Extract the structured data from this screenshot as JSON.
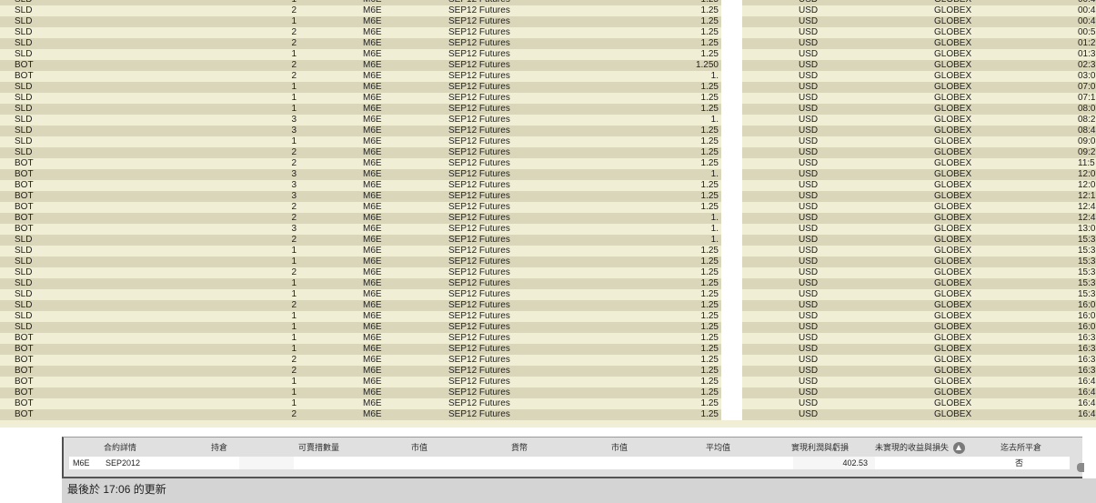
{
  "trades": {
    "rows": [
      {
        "action": "SLD",
        "qty": "1",
        "symbol": "M6E",
        "description": "SEP12 Futures",
        "price": "1.25",
        "currency": "USD",
        "exchange": "GLOBEX",
        "time": "00:4"
      },
      {
        "action": "SLD",
        "qty": "2",
        "symbol": "M6E",
        "description": "SEP12 Futures",
        "price": "1.25",
        "currency": "USD",
        "exchange": "GLOBEX",
        "time": "00:4"
      },
      {
        "action": "SLD",
        "qty": "1",
        "symbol": "M6E",
        "description": "SEP12 Futures",
        "price": "1.25",
        "currency": "USD",
        "exchange": "GLOBEX",
        "time": "00:4"
      },
      {
        "action": "SLD",
        "qty": "2",
        "symbol": "M6E",
        "description": "SEP12 Futures",
        "price": "1.25",
        "currency": "USD",
        "exchange": "GLOBEX",
        "time": "00:5"
      },
      {
        "action": "SLD",
        "qty": "2",
        "symbol": "M6E",
        "description": "SEP12 Futures",
        "price": "1.25",
        "currency": "USD",
        "exchange": "GLOBEX",
        "time": "01:2"
      },
      {
        "action": "SLD",
        "qty": "1",
        "symbol": "M6E",
        "description": "SEP12 Futures",
        "price": "1.25",
        "currency": "USD",
        "exchange": "GLOBEX",
        "time": "01:3"
      },
      {
        "action": "BOT",
        "qty": "2",
        "symbol": "M6E",
        "description": "SEP12 Futures",
        "price": "1.250",
        "currency": "USD",
        "exchange": "GLOBEX",
        "time": "02:3"
      },
      {
        "action": "BOT",
        "qty": "2",
        "symbol": "M6E",
        "description": "SEP12 Futures",
        "price": "1.",
        "currency": "USD",
        "exchange": "GLOBEX",
        "time": "03:0"
      },
      {
        "action": "SLD",
        "qty": "1",
        "symbol": "M6E",
        "description": "SEP12 Futures",
        "price": "1.25",
        "currency": "USD",
        "exchange": "GLOBEX",
        "time": "07:0"
      },
      {
        "action": "SLD",
        "qty": "1",
        "symbol": "M6E",
        "description": "SEP12 Futures",
        "price": "1.25",
        "currency": "USD",
        "exchange": "GLOBEX",
        "time": "07:1"
      },
      {
        "action": "SLD",
        "qty": "1",
        "symbol": "M6E",
        "description": "SEP12 Futures",
        "price": "1.25",
        "currency": "USD",
        "exchange": "GLOBEX",
        "time": "08:0"
      },
      {
        "action": "SLD",
        "qty": "3",
        "symbol": "M6E",
        "description": "SEP12 Futures",
        "price": "1.",
        "currency": "USD",
        "exchange": "GLOBEX",
        "time": "08:2"
      },
      {
        "action": "SLD",
        "qty": "3",
        "symbol": "M6E",
        "description": "SEP12 Futures",
        "price": "1.25",
        "currency": "USD",
        "exchange": "GLOBEX",
        "time": "08:4"
      },
      {
        "action": "SLD",
        "qty": "1",
        "symbol": "M6E",
        "description": "SEP12 Futures",
        "price": "1.25",
        "currency": "USD",
        "exchange": "GLOBEX",
        "time": "09:0"
      },
      {
        "action": "SLD",
        "qty": "2",
        "symbol": "M6E",
        "description": "SEP12 Futures",
        "price": "1.25",
        "currency": "USD",
        "exchange": "GLOBEX",
        "time": "09:2"
      },
      {
        "action": "BOT",
        "qty": "2",
        "symbol": "M6E",
        "description": "SEP12 Futures",
        "price": "1.25",
        "currency": "USD",
        "exchange": "GLOBEX",
        "time": "11:5"
      },
      {
        "action": "BOT",
        "qty": "3",
        "symbol": "M6E",
        "description": "SEP12 Futures",
        "price": "1.",
        "currency": "USD",
        "exchange": "GLOBEX",
        "time": "12:0"
      },
      {
        "action": "BOT",
        "qty": "3",
        "symbol": "M6E",
        "description": "SEP12 Futures",
        "price": "1.25",
        "currency": "USD",
        "exchange": "GLOBEX",
        "time": "12:0"
      },
      {
        "action": "BOT",
        "qty": "3",
        "symbol": "M6E",
        "description": "SEP12 Futures",
        "price": "1.25",
        "currency": "USD",
        "exchange": "GLOBEX",
        "time": "12:1"
      },
      {
        "action": "BOT",
        "qty": "2",
        "symbol": "M6E",
        "description": "SEP12 Futures",
        "price": "1.25",
        "currency": "USD",
        "exchange": "GLOBEX",
        "time": "12:4"
      },
      {
        "action": "BOT",
        "qty": "2",
        "symbol": "M6E",
        "description": "SEP12 Futures",
        "price": "1.",
        "currency": "USD",
        "exchange": "GLOBEX",
        "time": "12:4"
      },
      {
        "action": "BOT",
        "qty": "3",
        "symbol": "M6E",
        "description": "SEP12 Futures",
        "price": "1.",
        "currency": "USD",
        "exchange": "GLOBEX",
        "time": "13:0"
      },
      {
        "action": "SLD",
        "qty": "2",
        "symbol": "M6E",
        "description": "SEP12 Futures",
        "price": "1.",
        "currency": "USD",
        "exchange": "GLOBEX",
        "time": "15:3"
      },
      {
        "action": "SLD",
        "qty": "1",
        "symbol": "M6E",
        "description": "SEP12 Futures",
        "price": "1.25",
        "currency": "USD",
        "exchange": "GLOBEX",
        "time": "15:3"
      },
      {
        "action": "SLD",
        "qty": "1",
        "symbol": "M6E",
        "description": "SEP12 Futures",
        "price": "1.25",
        "currency": "USD",
        "exchange": "GLOBEX",
        "time": "15:3"
      },
      {
        "action": "SLD",
        "qty": "2",
        "symbol": "M6E",
        "description": "SEP12 Futures",
        "price": "1.25",
        "currency": "USD",
        "exchange": "GLOBEX",
        "time": "15:3"
      },
      {
        "action": "SLD",
        "qty": "1",
        "symbol": "M6E",
        "description": "SEP12 Futures",
        "price": "1.25",
        "currency": "USD",
        "exchange": "GLOBEX",
        "time": "15:3"
      },
      {
        "action": "SLD",
        "qty": "1",
        "symbol": "M6E",
        "description": "SEP12 Futures",
        "price": "1.25",
        "currency": "USD",
        "exchange": "GLOBEX",
        "time": "15:3"
      },
      {
        "action": "SLD",
        "qty": "2",
        "symbol": "M6E",
        "description": "SEP12 Futures",
        "price": "1.25",
        "currency": "USD",
        "exchange": "GLOBEX",
        "time": "16:0"
      },
      {
        "action": "SLD",
        "qty": "1",
        "symbol": "M6E",
        "description": "SEP12 Futures",
        "price": "1.25",
        "currency": "USD",
        "exchange": "GLOBEX",
        "time": "16:0"
      },
      {
        "action": "SLD",
        "qty": "1",
        "symbol": "M6E",
        "description": "SEP12 Futures",
        "price": "1.25",
        "currency": "USD",
        "exchange": "GLOBEX",
        "time": "16:0"
      },
      {
        "action": "BOT",
        "qty": "1",
        "symbol": "M6E",
        "description": "SEP12 Futures",
        "price": "1.25",
        "currency": "USD",
        "exchange": "GLOBEX",
        "time": "16:3"
      },
      {
        "action": "BOT",
        "qty": "1",
        "symbol": "M6E",
        "description": "SEP12 Futures",
        "price": "1.25",
        "currency": "USD",
        "exchange": "GLOBEX",
        "time": "16:3"
      },
      {
        "action": "BOT",
        "qty": "2",
        "symbol": "M6E",
        "description": "SEP12 Futures",
        "price": "1.25",
        "currency": "USD",
        "exchange": "GLOBEX",
        "time": "16:3"
      },
      {
        "action": "BOT",
        "qty": "2",
        "symbol": "M6E",
        "description": "SEP12 Futures",
        "price": "1.25",
        "currency": "USD",
        "exchange": "GLOBEX",
        "time": "16:3"
      },
      {
        "action": "BOT",
        "qty": "1",
        "symbol": "M6E",
        "description": "SEP12 Futures",
        "price": "1.25",
        "currency": "USD",
        "exchange": "GLOBEX",
        "time": "16:4"
      },
      {
        "action": "BOT",
        "qty": "1",
        "symbol": "M6E",
        "description": "SEP12 Futures",
        "price": "1.25",
        "currency": "USD",
        "exchange": "GLOBEX",
        "time": "16:4"
      },
      {
        "action": "BOT",
        "qty": "1",
        "symbol": "M6E",
        "description": "SEP12 Futures",
        "price": "1.25",
        "currency": "USD",
        "exchange": "GLOBEX",
        "time": "16:4"
      },
      {
        "action": "BOT",
        "qty": "2",
        "symbol": "M6E",
        "description": "SEP12 Futures",
        "price": "1.25",
        "currency": "USD",
        "exchange": "GLOBEX",
        "time": "16:4"
      }
    ]
  },
  "portfolio": {
    "headers": {
      "contract": "合約詳情",
      "position": "持倉",
      "available": "可賣措數量",
      "market_value": "市值",
      "currency": "貨幣",
      "market_price": "市值",
      "avg_price": "平均值",
      "realized_pnl": "實現利潤與虧損",
      "unrealized_pnl": "未實現的收益與損失",
      "closed": "迄去所平倉"
    },
    "row": {
      "symbol": "M6E",
      "expiry": "SEP2012",
      "realized_pnl": "402.53",
      "closed": "否"
    }
  },
  "status": {
    "last_updated": "最後於 17:06 的更新"
  }
}
